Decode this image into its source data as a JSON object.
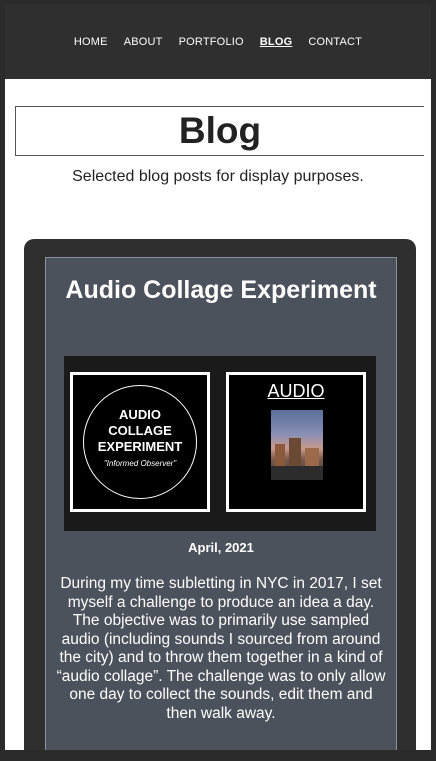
{
  "nav": {
    "items": [
      {
        "label": "HOME"
      },
      {
        "label": "ABOUT"
      },
      {
        "label": "PORTFOLIO"
      },
      {
        "label": "BLOG",
        "active": true
      },
      {
        "label": "CONTACT"
      }
    ]
  },
  "page": {
    "title": "Blog",
    "subtitle": "Selected blog posts for display purposes."
  },
  "post": {
    "title": "Audio Collage Experiment",
    "logo_lines": [
      "AUDIO",
      "COLLAGE",
      "EXPERIMENT"
    ],
    "logo_tagline": "\"Informed Observer\"",
    "audio_label": "AUDIO",
    "date": "April, 2021",
    "body": "During my time subletting in NYC in 2017, I set myself a challenge to produce an idea a day. The objective was to primarily use sampled audio (including sounds I sourced from around the city) and to throw them together in a kind of “audio collage”. The challenge was to only allow one day to collect the sounds, edit them and then walk away."
  },
  "colors": {
    "nav_bg": "#2f2f2f",
    "card_bg": "#4b525c",
    "accent_text": "#ffffff"
  }
}
